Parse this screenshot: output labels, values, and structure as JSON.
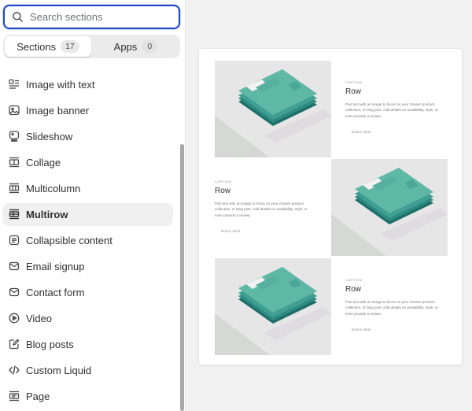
{
  "search": {
    "placeholder": "Search sections",
    "value": ""
  },
  "tabs": [
    {
      "label": "Sections",
      "count": "17"
    },
    {
      "label": "Apps",
      "count": "0"
    }
  ],
  "sections": [
    {
      "label": "Image with text",
      "icon": "image-with-text-icon"
    },
    {
      "label": "Image banner",
      "icon": "image-banner-icon"
    },
    {
      "label": "Slideshow",
      "icon": "slideshow-icon"
    },
    {
      "label": "Collage",
      "icon": "collage-icon"
    },
    {
      "label": "Multicolumn",
      "icon": "multicolumn-icon"
    },
    {
      "label": "Multirow",
      "icon": "multirow-icon"
    },
    {
      "label": "Collapsible content",
      "icon": "collapsible-content-icon"
    },
    {
      "label": "Email signup",
      "icon": "email-icon"
    },
    {
      "label": "Contact form",
      "icon": "email-icon"
    },
    {
      "label": "Video",
      "icon": "play-icon"
    },
    {
      "label": "Blog posts",
      "icon": "blog-icon"
    },
    {
      "label": "Custom Liquid",
      "icon": "code-icon"
    },
    {
      "label": "Page",
      "icon": "page-icon"
    }
  ],
  "active_section": "Multirow",
  "preview": {
    "rows": [
      {
        "caption": "Caption",
        "title": "Row",
        "text": "Pair text with an image to focus on your chosen product, collection, or blog post. Add details on availability, style, or even provide a review.",
        "button": "Button label"
      },
      {
        "caption": "Caption",
        "title": "Row",
        "text": "Pair text with an image to focus on your chosen product, collection, or blog post. Add details on availability, style, or even provide a review.",
        "button": "Button label"
      },
      {
        "caption": "Caption",
        "title": "Row",
        "text": "Pair text with an image to focus on your chosen product, collection, or blog post. Add details on availability, style, or even provide a review.",
        "button": "Button label"
      }
    ]
  },
  "colors": {
    "focus": "#1f47c6",
    "shirt": "#5fb8a6",
    "shirt_dark": "#2f8b82"
  }
}
